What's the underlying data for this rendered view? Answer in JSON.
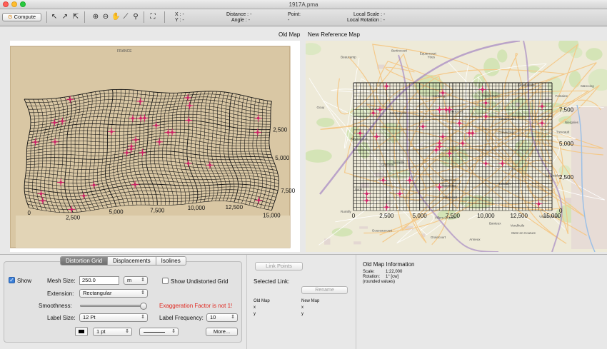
{
  "window": {
    "title": "1917A.pma"
  },
  "toolbar": {
    "compute_label": "Compute",
    "x_label": "X : -",
    "y_label": "Y : -",
    "distance_label": "Distance : -",
    "angle_label": "Angle : -",
    "point_label": "Point:",
    "point_value": "-",
    "local_scale_label": "Local Scale : -",
    "local_rotation_label": "Local Rotation : -"
  },
  "panels": {
    "old_map_title": "Old Map",
    "new_map_title": "New Reference Map"
  },
  "old_map": {
    "x_ticks": [
      "0",
      "2,500",
      "5,000",
      "7,500",
      "10,000",
      "12,500",
      "15,000"
    ],
    "y_ticks": [
      "7,500",
      "5,000",
      "2,500"
    ],
    "top_strip_text": "FRANCE"
  },
  "new_map": {
    "x_ticks": [
      "0",
      "2,500",
      "5,000",
      "7,500",
      "10,000",
      "12,500",
      "15,000"
    ],
    "y_ticks": [
      "7,500",
      "5,000",
      "2,500",
      "0"
    ],
    "place_labels": [
      "Ruyaulcourt",
      "Bertincourt",
      "Havrincourt",
      "Flesquières",
      "Ribécourt",
      "Marcoing",
      "Cantaing",
      "Fontaine",
      "Graincourt",
      "Anneux",
      "Villers-Plouich",
      "Gouzeaucourt",
      "Gonnelieu",
      "Banteux",
      "Crèvecœur",
      "Masnières",
      "Lesdain",
      "Rumilly",
      "Niergnies",
      "Cambrai",
      "Trescault",
      "Beaucamp",
      "Metz-en-Couture",
      "Neuville",
      "Ytres",
      "Equancourt",
      "Fins",
      "Sorel",
      "Heudicourt",
      "Villers-Guislain",
      "Honnecourt",
      "Vendhuile",
      "Le Catelet",
      "Bantouzelle",
      "Gouy",
      "Nauroy"
    ]
  },
  "tabs": [
    {
      "label": "Distortion Grid",
      "active": true
    },
    {
      "label": "Displacements",
      "active": false
    },
    {
      "label": "Isolines",
      "active": false
    }
  ],
  "distortion": {
    "show_label": "Show",
    "show_checked": true,
    "mesh_size_label": "Mesh Size:",
    "mesh_size_value": "250.0",
    "mesh_unit": "m",
    "show_undistorted_label": "Show Undistorted Grid",
    "show_undistorted_checked": false,
    "extension_label": "Extension:",
    "extension_value": "Rectangular",
    "smoothness_label": "Smoothness:",
    "smoothness_level": 0.95,
    "exaggeration_warning": "Exaggeration Factor is not 1!",
    "label_size_label": "Label Size:",
    "label_size_value": "12 Pt",
    "label_frequency_label": "Label Frequency:",
    "label_frequency_value": "10",
    "line_width_value": "1 pt",
    "more_label": "More..."
  },
  "links": {
    "link_points_label": "Link Points",
    "selected_link_label": "Selected Link:",
    "rename_label": "Rename",
    "old_map_label": "Old Map",
    "new_map_label": "New Map",
    "x_label": "x",
    "y_label": "y"
  },
  "info": {
    "title": "Old Map Information",
    "scale_label": "Scale:",
    "scale_value": "1:22,000",
    "rotation_label": "Rotation:",
    "rotation_value": "1° [cw]",
    "note": "(rounded values)"
  },
  "colors": {
    "accent": "#3b7fd8",
    "warning": "#e0261e",
    "marker": "#cc2266",
    "paper": "#d9c7a4"
  }
}
